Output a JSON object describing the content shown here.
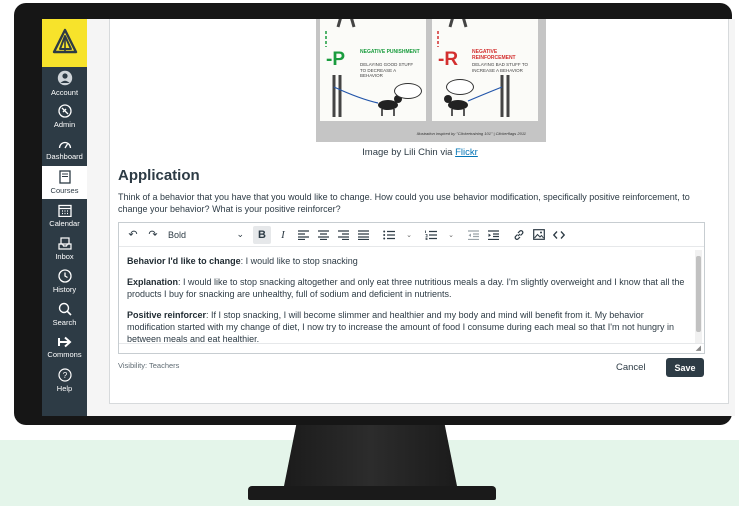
{
  "nav": {
    "items": [
      {
        "label": "Account",
        "icon": "account-icon"
      },
      {
        "label": "Admin",
        "icon": "admin-shield-icon"
      },
      {
        "label": "Dashboard",
        "icon": "dashboard-gauge-icon"
      },
      {
        "label": "Courses",
        "icon": "courses-book-icon",
        "active": true
      },
      {
        "label": "Calendar",
        "icon": "calendar-icon"
      },
      {
        "label": "Inbox",
        "icon": "inbox-icon"
      },
      {
        "label": "History",
        "icon": "history-clock-icon"
      },
      {
        "label": "Search",
        "icon": "search-icon"
      },
      {
        "label": "Commons",
        "icon": "commons-arrow-icon"
      },
      {
        "label": "Help",
        "icon": "help-icon"
      }
    ],
    "brand_color": "#f7e32b",
    "bg_color": "#2d3b45"
  },
  "figure": {
    "left_tag": "-P",
    "left_heading": "NEGATIVE PUNISHMENT",
    "left_subheading": "DELAYING GOOD STUFF TO DECREASE A BEHAVIOR",
    "right_tag": "-R",
    "right_heading": "NEGATIVE REINFORCEMENT",
    "right_subheading": "DELAYING BAD STUFF TO INCREASE A BEHAVIOR",
    "credit": "Illustration inspired by \"Clickertraining 101\" | Clickerflags 2011",
    "caption_prefix": "Image by Lili Chin via",
    "caption_link": "Flickr"
  },
  "section": {
    "title": "Application",
    "prompt": "Think of a behavior that you have that you would like to change. How could you use behavior modification, specifically positive reinforcement, to change your behavior? What is your positive reinforcer?"
  },
  "toolbar": {
    "undo": "↶",
    "redo": "↷",
    "format_select": "Bold",
    "bold": "B",
    "italic": "I"
  },
  "answer": {
    "p1_label": "Behavior I'd like to change",
    "p1_text": ": I would like to stop snacking",
    "p2_label": "Explanation",
    "p2_text": ": I would like to stop snacking altogether and only eat three nutritious meals a day. I'm slightly overweight and I know that all the products I buy for snacking are unhealthy, full of sodium and deficient in nutrients.",
    "p3_label": "Positive reinforcer",
    "p3_text": ": If I stop snacking, I will become slimmer and healthier and my body and mind will benefit from it. My behavior modification started with my change of diet, I now try to increase the amount of food I consume during each meal so that I'm not hungry in between meals and eat healthier."
  },
  "footer": {
    "visibility": "Visibility: Teachers",
    "cancel": "Cancel",
    "save": "Save"
  }
}
